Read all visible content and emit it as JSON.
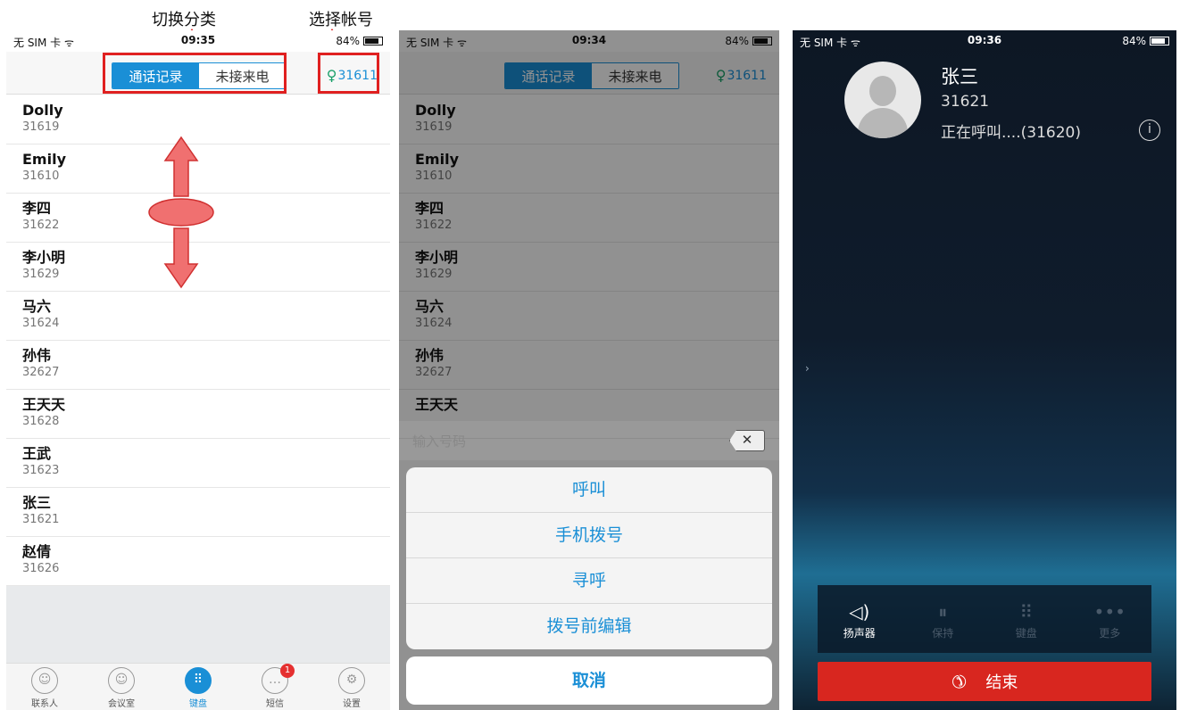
{
  "annotations": {
    "switch_category": "切换分类",
    "select_account": "选择帐号"
  },
  "colors": {
    "accent": "#1a8fd6",
    "highlight": "#e02020",
    "end_call": "#d8261f"
  },
  "phone1": {
    "status": {
      "carrier": "无 SIM 卡 ᯤ",
      "time": "09:35",
      "battery": "84%"
    },
    "tabs": {
      "call_log": "通话记录",
      "missed": "未接来电"
    },
    "account": "31611",
    "contacts": [
      {
        "name": "Dolly",
        "number": "31619"
      },
      {
        "name": "Emily",
        "number": "31610"
      },
      {
        "name": "李四",
        "number": "31622"
      },
      {
        "name": "李小明",
        "number": "31629"
      },
      {
        "name": "马六",
        "number": "31624"
      },
      {
        "name": "孙伟",
        "number": "32627"
      },
      {
        "name": "王天天",
        "number": "31628"
      },
      {
        "name": "王武",
        "number": "31623"
      },
      {
        "name": "张三",
        "number": "31621"
      },
      {
        "name": "赵倩",
        "number": "31626"
      }
    ],
    "tabbar": [
      {
        "label": "联系人",
        "icon": "contacts-icon"
      },
      {
        "label": "会议室",
        "icon": "meeting-icon"
      },
      {
        "label": "键盘",
        "icon": "keypad-icon"
      },
      {
        "label": "短信",
        "icon": "message-icon",
        "badge": "1"
      },
      {
        "label": "设置",
        "icon": "settings-icon"
      }
    ]
  },
  "phone2": {
    "status": {
      "carrier": "无 SIM 卡 ᯤ",
      "time": "09:34",
      "battery": "84%"
    },
    "tabs": {
      "call_log": "通话记录",
      "missed": "未接来电"
    },
    "account": "31611",
    "contacts": [
      {
        "name": "Dolly",
        "number": "31619"
      },
      {
        "name": "Emily",
        "number": "31610"
      },
      {
        "name": "李四",
        "number": "31622"
      },
      {
        "name": "李小明",
        "number": "31629"
      },
      {
        "name": "马六",
        "number": "31624"
      },
      {
        "name": "孙伟",
        "number": "32627"
      },
      {
        "name": "王天天",
        "number": ""
      }
    ],
    "input_placeholder": "输入号码",
    "actions": [
      "呼叫",
      "手机拨号",
      "寻呼",
      "拨号前编辑"
    ],
    "cancel": "取消"
  },
  "phone3": {
    "status": {
      "carrier": "无 SIM 卡 ᯤ",
      "time": "09:36",
      "battery": "84%"
    },
    "callee_name": "张三",
    "callee_number": "31621",
    "call_status": "正在呼叫....(31620)",
    "controls": [
      {
        "label": "扬声器",
        "icon": "speaker-icon",
        "enabled": true
      },
      {
        "label": "保持",
        "icon": "hold-icon",
        "enabled": false
      },
      {
        "label": "键盘",
        "icon": "keypad-icon",
        "enabled": false
      },
      {
        "label": "更多",
        "icon": "more-icon",
        "enabled": false
      }
    ],
    "end_call": "结束"
  }
}
